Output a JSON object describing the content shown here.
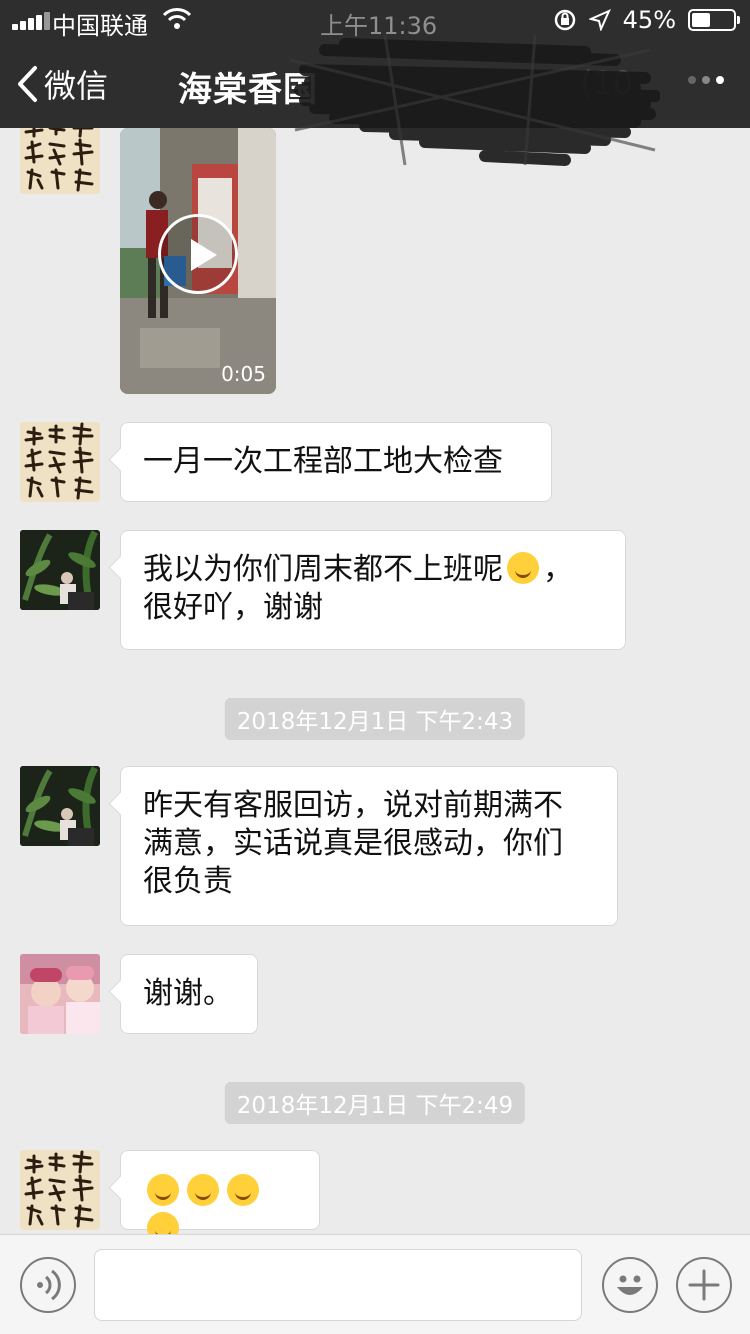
{
  "status_bar": {
    "carrier": "中国联通",
    "time": "上午11:36",
    "battery_percent": "45%",
    "battery_level": 0.45
  },
  "nav": {
    "back_label": "微信",
    "title": "海棠香国",
    "member_count": "(10"
  },
  "messages": [
    {
      "kind": "video",
      "sender": "calligraphy",
      "duration": "0:05"
    },
    {
      "kind": "text",
      "sender": "calligraphy",
      "text": "一月一次工程部工地大检查"
    },
    {
      "kind": "text",
      "sender": "plant",
      "line1": "我以为你们周末都不上班呢",
      "line1_end": "，",
      "line2": "很好吖，谢谢"
    },
    {
      "kind": "timestamp",
      "text": "2018年12月1日 下午2:43"
    },
    {
      "kind": "text",
      "sender": "plant",
      "line1": "昨天有客服回访，说对前期满不",
      "line2": "满意，实话说真是很感动，你们",
      "line3": "很负责"
    },
    {
      "kind": "text",
      "sender": "baby",
      "text": "谢谢。"
    },
    {
      "kind": "timestamp",
      "text": "2018年12月1日 下午2:49"
    },
    {
      "kind": "emoji",
      "sender": "calligraphy",
      "count": 4
    }
  ],
  "colors": {
    "nav_bg": "#2e2e2e",
    "chat_bg": "#ebebeb",
    "bubble_bg": "#ffffff",
    "timestamp_bg": "#d3d3d3"
  }
}
